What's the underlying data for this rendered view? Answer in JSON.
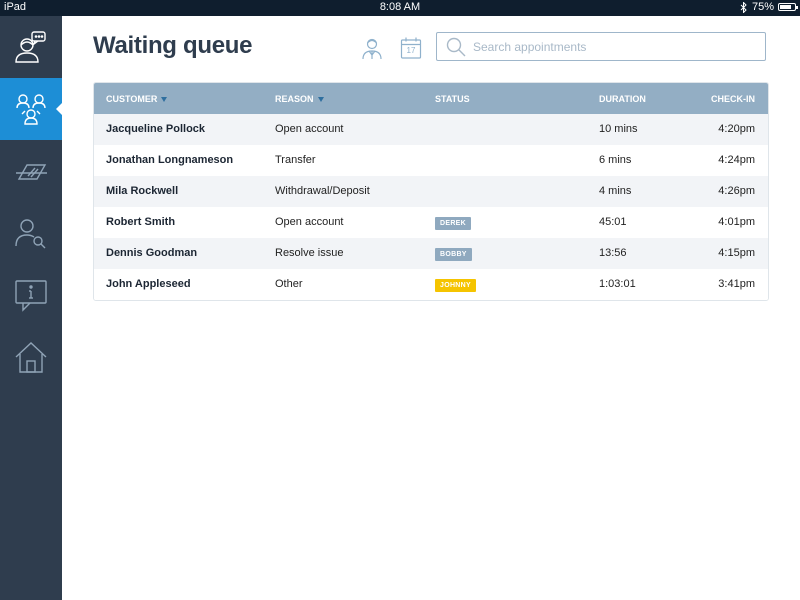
{
  "status_bar": {
    "device": "iPad",
    "time": "8:08 AM",
    "battery": "75%",
    "battery_fraction": 0.75,
    "bluetooth_icon": "bluetooth-icon"
  },
  "sidebar": {
    "items": [
      {
        "name": "advisor-chat",
        "icon": "person-speech-icon",
        "active": false
      },
      {
        "name": "waiting-queue",
        "icon": "group-people-icon",
        "active": true
      },
      {
        "name": "transactions",
        "icon": "card-swipe-icon",
        "active": false
      },
      {
        "name": "customer-search",
        "icon": "person-search-icon",
        "active": false
      },
      {
        "name": "info",
        "icon": "info-bubble-icon",
        "active": false
      },
      {
        "name": "home",
        "icon": "home-icon",
        "active": false
      }
    ]
  },
  "header": {
    "title": "Waiting queue",
    "calendar_day": "17",
    "search": {
      "placeholder": "Search appointments",
      "value": ""
    }
  },
  "table": {
    "columns": {
      "customer": "CUSTOMER",
      "reason": "REASON",
      "status": "STATUS",
      "duration": "DURATION",
      "checkin": "CHECK-IN"
    },
    "rows": [
      {
        "customer": "Jacqueline Pollock",
        "reason": "Open account",
        "status": "",
        "duration": "10 mins",
        "checkin": "4:20pm"
      },
      {
        "customer": "Jonathan Longnameson",
        "reason": "Transfer",
        "status": "",
        "duration": "6 mins",
        "checkin": "4:24pm"
      },
      {
        "customer": "Mila Rockwell",
        "reason": "Withdrawal/Deposit",
        "status": "",
        "duration": "4 mins",
        "checkin": "4:26pm"
      },
      {
        "customer": "Robert Smith",
        "reason": "Open account",
        "status": "DEREK",
        "status_color": "#8fa9bf",
        "duration": "45:01",
        "checkin": "4:01pm"
      },
      {
        "customer": "Dennis Goodman",
        "reason": "Resolve issue",
        "status": "BOBBY",
        "status_color": "#8fa9bf",
        "duration": "13:56",
        "checkin": "4:15pm"
      },
      {
        "customer": "John Appleseed",
        "reason": "Other",
        "status": "JOHNNY",
        "status_color": "#f5c400",
        "duration": "1:03:01",
        "checkin": "3:41pm"
      }
    ]
  },
  "colors": {
    "sidebar": "#2f3d4e",
    "active": "#1d8ed6",
    "table_header": "#93aec4",
    "title": "#2f3d4e"
  }
}
